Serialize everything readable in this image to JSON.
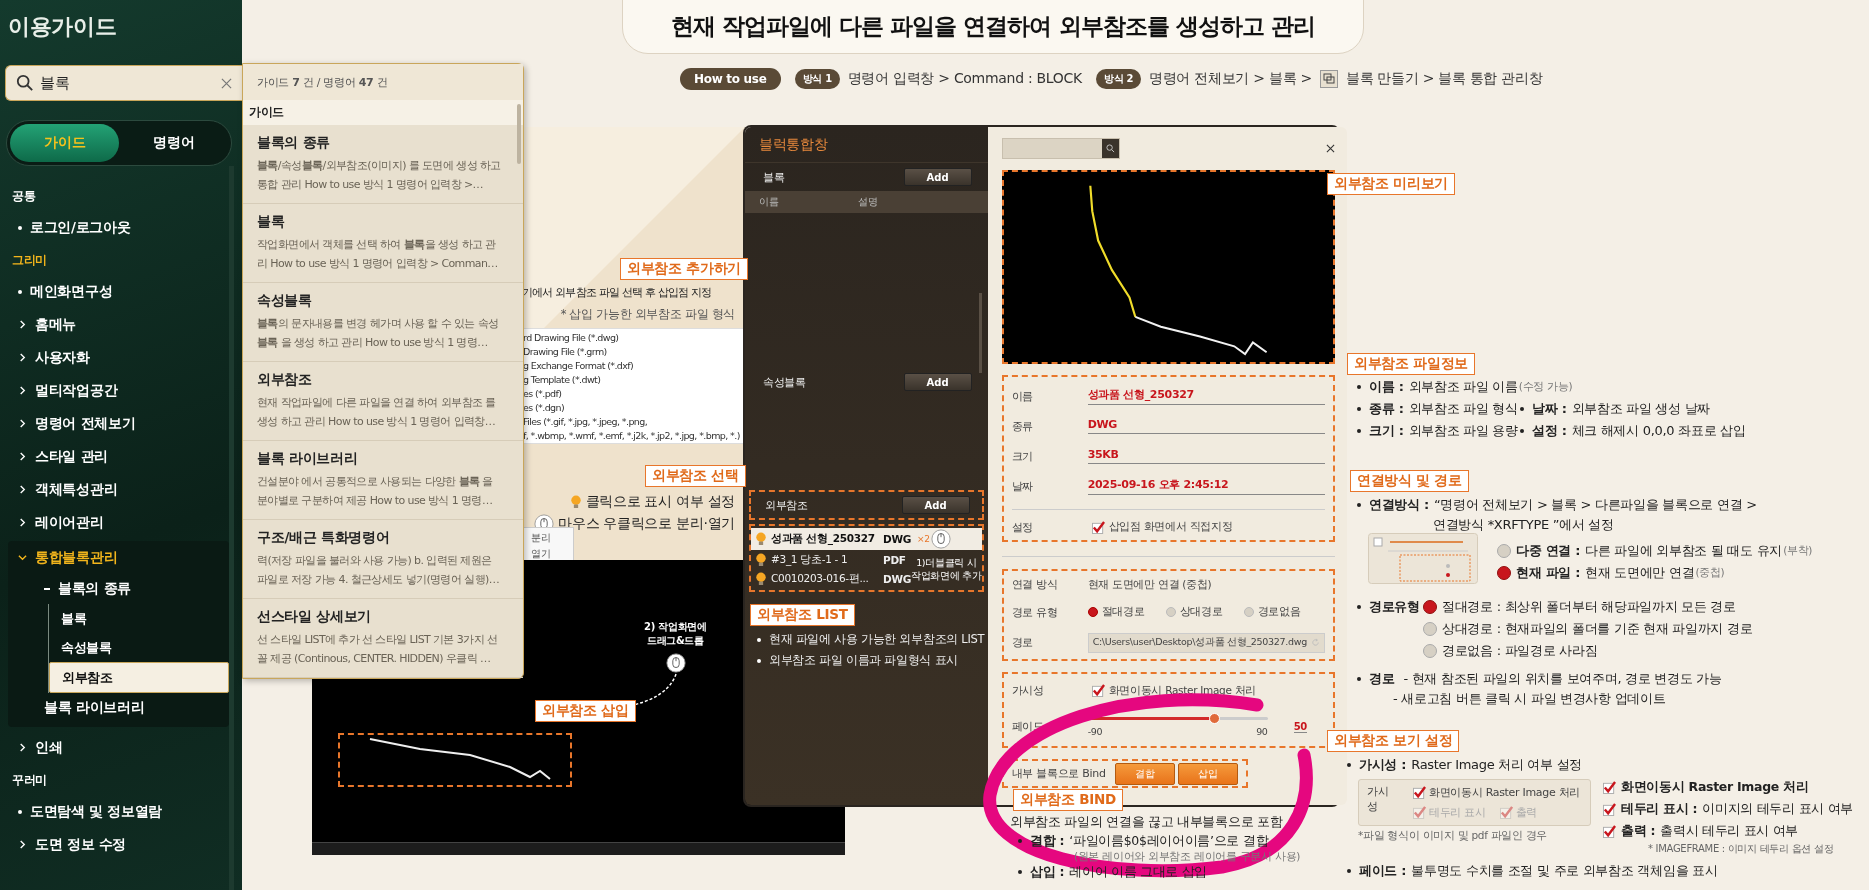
{
  "sidebar": {
    "title": "이용가이드",
    "search": {
      "value": "블록"
    },
    "modes": [
      {
        "label": "가이드",
        "selected": true
      },
      {
        "label": "명령어",
        "selected": false
      }
    ],
    "sections": [
      {
        "heading": "공통",
        "active": false,
        "items": [
          {
            "label": "로그인/로그아웃",
            "kind": "bullet"
          }
        ]
      },
      {
        "heading": "그리미",
        "active": true,
        "items": [
          {
            "label": "메인화면구성",
            "kind": "bullet"
          },
          {
            "label": "홈메뉴",
            "kind": "folder",
            "expanded": false
          },
          {
            "label": "사용자화",
            "kind": "folder",
            "expanded": false
          },
          {
            "label": "멀티작업공간",
            "kind": "folder",
            "expanded": false
          },
          {
            "label": "명령어 전체보기",
            "kind": "folder",
            "expanded": false
          },
          {
            "label": "스타일 관리",
            "kind": "folder",
            "expanded": false
          },
          {
            "label": "객체특성관리",
            "kind": "folder",
            "expanded": false
          },
          {
            "label": "레이어관리",
            "kind": "folder",
            "expanded": false
          },
          {
            "label": "통합블록관리",
            "kind": "folder",
            "expanded": true,
            "children": [
              {
                "label": "블록의 종류",
                "kind": "group",
                "children": [
                  {
                    "label": "블록",
                    "selected": false
                  },
                  {
                    "label": "속성블록",
                    "selected": false
                  },
                  {
                    "label": "외부참조",
                    "selected": true
                  }
                ]
              },
              {
                "label": "블록 라이브러리",
                "kind": "page"
              }
            ]
          },
          {
            "label": "인쇄",
            "kind": "folder",
            "expanded": false
          }
        ]
      },
      {
        "heading": "꾸러미",
        "active": false,
        "items": [
          {
            "label": "도면탐색 및 정보열람",
            "kind": "bullet"
          },
          {
            "label": "도면 정보 수정",
            "kind": "folder",
            "expanded": false
          }
        ]
      }
    ]
  },
  "search_panel": {
    "summary": "가이드 **7** 건 / 명령어 **47** 건",
    "section": "가이드",
    "results": [
      {
        "title": "**블록**의 종류",
        "snippet": "**블록**/속성**블록**/외부참조(이미지) 를 도면에 생성 하고 통합 관리 How to use 방식 1 명령어 입력창 >…"
      },
      {
        "title": "**블록**",
        "snippet": "작업화면에서 객체를 선택 하여 **블록**을 생성 하고 관리 How to use 방식 1 명령어 입력창 > Comman…"
      },
      {
        "title": "속성**블록**",
        "snippet": "**블록**의 문자내용를 변경 헤가며 사용 할 수 있는 속성 **블록** 을 생성 하고 관리 How to use 방식 1 명령…"
      },
      {
        "title": "외부참조",
        "snippet": "현재 작업파일에 다른 파일을 연결 하여 외부참조 를 생성 하고 관리 How to use 방식 1 명령어 입력창…"
      },
      {
        "title": "**블록** 라이브러리",
        "snippet": "건설분야 에서 공통적으로 사용되는 다양한 **블록** 을 분야별로 구분하여 제공 How to use 방식 1 명령…"
      },
      {
        "title": "구조/배근 특화명령어",
        "snippet": "력(저장 파일을 불러와 사용 가능) b. 입력된 제원은 파일로 저장 가능 4. 철근상세도 넣기(명령어 실행)…"
      },
      {
        "title": "선스타일 상세보기",
        "snippet": "선 스타일 LIST에 추가 선 스타일 LIST 기본 3가지 선 꼴 제공 (Continous, CENTER. HIDDEN) 우클릭 …"
      }
    ]
  },
  "main": {
    "title": "현재 작업파일에 **다른 파일을 연결**하여 **외부참조**를 **생성**하고 **관리**",
    "how_to": {
      "label": "How to use",
      "methods": [
        {
          "badge": "방식 1",
          "path": "명령어 입력창 > Command : BLOCK"
        },
        {
          "badge": "방식 2",
          "path": "명령어 전체보기 > 블록 >",
          "icon": true,
          "path_after": "블록 만들기 > 블록 통합 관리창"
        }
      ]
    },
    "callouts": [
      "외부참조 추가하기",
      "외부참조 선택",
      "외부참조 삽입",
      "외부참조 LIST",
      "외부참조 미리보기",
      "외부참조 파일정보",
      "연결방식 및 경로",
      "외부참조 보기 설정",
      "외부참조 BIND"
    ],
    "file_dialog": {
      "instruction": "기에서 외부참조 파일 선택 후 삽입점 지정",
      "formats_note": "* 삽입 가능한 외부참조 파일 형식",
      "formats": [
        "rd Drawing File (*.dwg)",
        "Drawing File (*.grm)",
        "g Exchange Format (*.dxf)",
        "g Template (*.dwt)",
        "es (*.pdf)",
        "es (*.dgn)",
        "Files (*.gif, *.jpg, *.jpeg, *.png,",
        "f, *.wbmp, *.wmf, *.emf, *.j2k, *.jp2, *.jpg, *.bmp, *.)"
      ],
      "hints": [
        {
          "kind": "bulb",
          "text": "클릭으로 표시 여부 설정"
        },
        {
          "kind": "mouse",
          "text": "마우스 우클릭으로 분리·열기"
        }
      ],
      "context_menu": [
        "분리",
        "열기"
      ]
    },
    "viewport": {
      "drag_note": [
        "2) 작업화면에",
        "드래그&드롭"
      ]
    },
    "dialog": {
      "title": "블럭통합창",
      "groups": [
        {
          "label": "블록",
          "button": "Add"
        },
        {
          "label": "속성블록",
          "button": "Add"
        },
        {
          "label": "외부참조",
          "button": "Add"
        }
      ],
      "columns": [
        "이름",
        "설명"
      ],
      "xrefs": [
        {
          "name": "성과품 선형_250327",
          "type": "DWG",
          "selected": true
        },
        {
          "name": "#3_1 당초-1 - 1",
          "type": "PDF",
          "selected": false
        },
        {
          "name": "C0010203-016-편...",
          "type": "DWG",
          "selected": false
        }
      ],
      "double_click": {
        "count": "×2",
        "lines": [
          "1)더블클릭 시",
          "작업화면에 추가"
        ]
      },
      "list_notes": [
        "현재 파일에 사용 가능한 외부참조의 LIST",
        "외부참조 파일 이름과 파일형식 표시"
      ],
      "info": [
        {
          "label": "이름",
          "value": "성과품 선형_250327"
        },
        {
          "label": "종류",
          "value": "DWG"
        },
        {
          "label": "크기",
          "value": "35KB"
        },
        {
          "label": "날짜",
          "value": "2025-09-16 오후 2:45:12"
        }
      ],
      "setting": {
        "label": "설정",
        "text": "삽입점 화면에서 직접지정",
        "checked": true
      },
      "link": {
        "label": "연결 방식",
        "value": "현재 도면에만 연결 (중첩)"
      },
      "path_type": {
        "label": "경로 유형",
        "options": [
          {
            "label": "절대경로",
            "selected": true
          },
          {
            "label": "상대경로",
            "selected": false
          },
          {
            "label": "경로없음",
            "selected": false
          }
        ]
      },
      "path": {
        "label": "경로",
        "value": "C:\\Users\\user\\Desktop\\성과품 선형_250327.dwg"
      },
      "visibility": {
        "label": "가시성",
        "text": "화면이동시 Raster Image 처리",
        "checked": true
      },
      "fade": {
        "label": "페이드",
        "min": "-90",
        "max": "90",
        "value": "50",
        "level": 0.7
      },
      "bind": {
        "label": "내부 블록으로 Bind",
        "buttons": [
          "결합",
          "삽입"
        ]
      }
    },
    "bind_notes": {
      "intro": "외부참조 파일의 연결을 끊고 내부블록으로 포함",
      "items": [
        {
          "term": "결합 :",
          "desc": "‘파일이름$0$레이어이름’으로 결합",
          "note": "(원본 레이어와 외부참조 레이어를 구분시 사용)"
        },
        {
          "term": "삽입 :",
          "desc": "레이어 이름 그대로 삽입"
        }
      ]
    },
    "info_notes": [
      {
        "term": "이름 :",
        "desc": "외부참조 파일 이름",
        "note": "(수정 가능)"
      },
      {
        "term": "종류 :",
        "desc": "외부참조 파일 형식"
      },
      {
        "term": "날짜 :",
        "desc": "외부참조 파일 생성 날짜"
      },
      {
        "term": "크기 :",
        "desc": "외부참조 파일 용량"
      },
      {
        "term": "설정 :",
        "desc": "체크 해제시 0,0,0 좌표로 삽입"
      }
    ],
    "link_notes": {
      "term": "연결방식 :",
      "lines": [
        "“명령어 전체보기 > 블록 > 다른파일을 블록으로 연결 >",
        "연결방식 *XRFTYPE ”에서 설정"
      ],
      "modes": [
        {
          "term": "다중 연결 :",
          "desc": "다른 파일에 외부참조 될 때도 유지",
          "note": "(부착)",
          "selected": false
        },
        {
          "term": "현재 파일 :",
          "desc": "현재 도면에만 연결",
          "note": "(중첩)",
          "selected": true
        }
      ]
    },
    "path_type_notes": {
      "term": "경로유형",
      "options": [
        {
          "label": "절대경로 : 최상위 폴더부터 해당파일까지 모든 경로",
          "selected": true
        },
        {
          "label": "상대경로 : 현재파일의 폴더를 기준 현재 파일까지 경로",
          "selected": false
        },
        {
          "label": "경로없음 : 파일경로 사라짐",
          "selected": false
        }
      ]
    },
    "path_notes": {
      "term": "경로",
      "lines": [
        "- 현재 참조된 파일의 위치를 보여주며, 경로 변경도 가능",
        "- 새로고침 버튼 클릭 시 파일 변경사항 업데이트"
      ]
    },
    "view_notes": {
      "visibility": {
        "term": "가시성 :",
        "desc": "Raster Image 처리 여부 설정"
      },
      "sample": {
        "label": "가시성",
        "options": [
          {
            "label": "화면이동시 Raster Image 처리",
            "checked": true,
            "disabled": false
          },
          {
            "label": "테두리 표시",
            "checked": true,
            "disabled": true
          },
          {
            "label": "출력",
            "checked": true,
            "disabled": true
          }
        ]
      },
      "sample_note": "*파일 형식이 이미지 및 pdf 파일인 경우",
      "checks": [
        {
          "term": "화면이동시 Raster Image 처리",
          "checked": true
        },
        {
          "term": "테두리 표시 :",
          "desc": "이미지의 테두리 표시 여부",
          "checked": true
        },
        {
          "term": "출력 :",
          "desc": "출력시 테두리 표시 여부",
          "checked": true
        }
      ],
      "checks_note": "* IMAGEFRAME : 이미지 테두리 옵션 설정",
      "fade": {
        "term": "페이드 :",
        "desc": "불투명도 수치를 조절 및 주로 외부참조 객체임을 표시"
      }
    }
  }
}
